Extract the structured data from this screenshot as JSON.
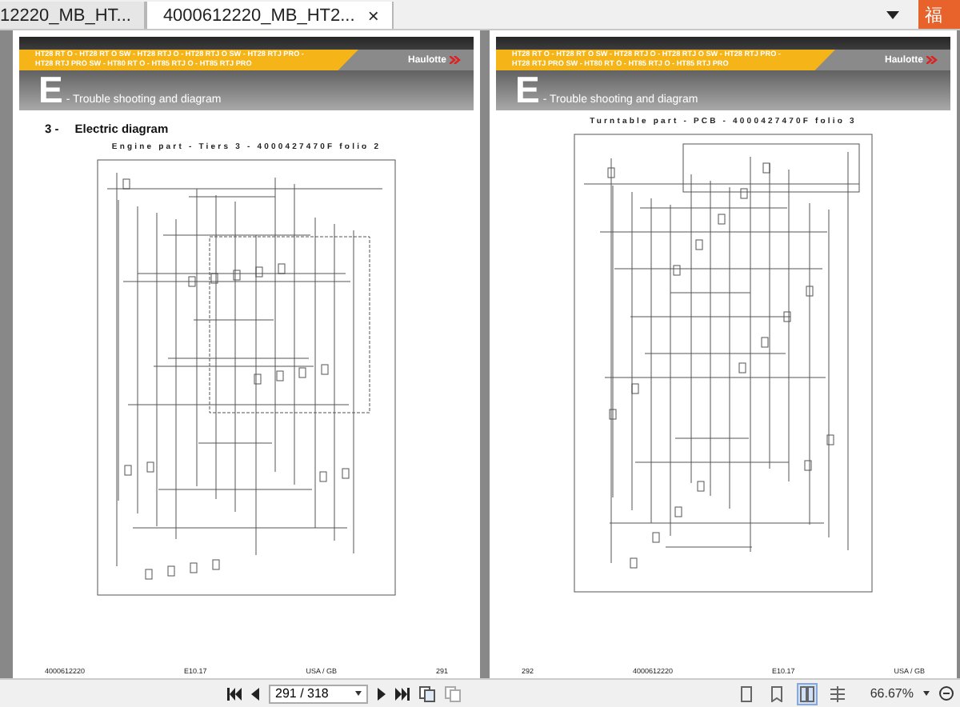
{
  "tabs": [
    {
      "label": "12220_MB_HT...",
      "selected": false
    },
    {
      "label": "4000612220_MB_HT2...",
      "selected": true,
      "close": "×"
    }
  ],
  "corner_badge": "福",
  "pages": [
    {
      "models": [
        "HT28 RT O - HT28 RT O SW - HT28 RTJ O - HT28 RTJ O SW - HT28 RTJ PRO -",
        "HT28 RTJ PRO SW - HT80 RT O - HT85 RTJ O - HT85 RTJ PRO"
      ],
      "logo": "Haulotte",
      "letter": "E",
      "section_title": "- Trouble shooting and diagram",
      "heading": {
        "number": "3 -",
        "text": "Electric diagram"
      },
      "diagram_title": "Engine part - Tiers 3 - 4000427470F folio 2",
      "footer": [
        "4000612220",
        "E10.17",
        "USA / GB",
        "291"
      ]
    },
    {
      "models": [
        "HT28 RT O - HT28 RT O SW - HT28 RTJ O - HT28 RTJ O SW - HT28 RTJ PRO -",
        "HT28 RTJ PRO SW - HT80 RT O - HT85 RTJ O - HT85 RTJ PRO"
      ],
      "logo": "Haulotte",
      "letter": "E",
      "section_title": "- Trouble shooting and diagram",
      "diagram_title": "Turntable part - PCB - 4000427470F folio 3",
      "footer": [
        "292",
        "4000612220",
        "E10.17",
        "USA / GB"
      ]
    }
  ],
  "toolbar": {
    "page_field": "291 / 318",
    "view_modes": [
      {
        "selected": false
      },
      {
        "selected": false
      },
      {
        "selected": true
      },
      {
        "selected": false
      }
    ],
    "zoom": "66.67%"
  }
}
